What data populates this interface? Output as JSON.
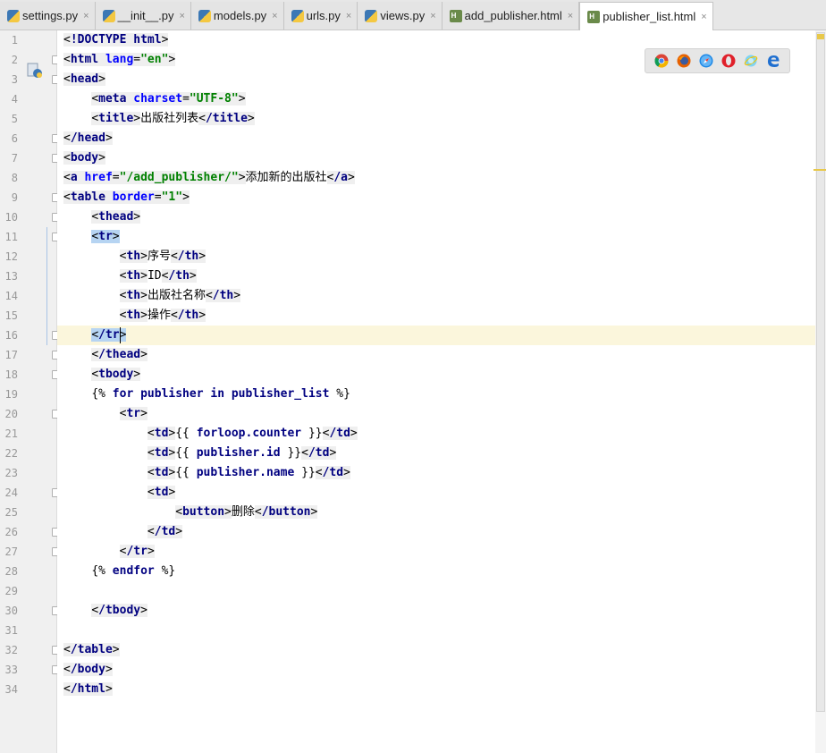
{
  "tabs": [
    {
      "label": "settings.py",
      "icon": "python-file-icon"
    },
    {
      "label": "__init__.py",
      "icon": "python-file-icon"
    },
    {
      "label": "models.py",
      "icon": "python-file-icon"
    },
    {
      "label": "urls.py",
      "icon": "python-file-icon"
    },
    {
      "label": "views.py",
      "icon": "python-file-icon"
    },
    {
      "label": "add_publisher.html",
      "icon": "html-file-icon"
    },
    {
      "label": "publisher_list.html",
      "icon": "html-file-icon",
      "active": true
    }
  ],
  "close_glyph": "×",
  "browsers": [
    "chrome",
    "firefox",
    "safari",
    "opera",
    "ie",
    "edge"
  ],
  "colors": {
    "tag": "#000080",
    "attr": "#0000ff",
    "string": "#008000",
    "caret_line": "#fbf6dc",
    "selection": "#b6d4f2"
  },
  "code": {
    "line_numbers": [
      "1",
      "2",
      "3",
      "4",
      "5",
      "6",
      "7",
      "8",
      "9",
      "10",
      "11",
      "12",
      "13",
      "14",
      "15",
      "16",
      "17",
      "18",
      "19",
      "20",
      "21",
      "22",
      "23",
      "24",
      "25",
      "26",
      "27",
      "28",
      "29",
      "30",
      "31",
      "32",
      "33",
      "34"
    ],
    "lines": [
      "<!DOCTYPE html>",
      "<html lang=\"en\">",
      "<head>",
      "    <meta charset=\"UTF-8\">",
      "    <title>出版社列表</title>",
      "</head>",
      "<body>",
      "<a href=\"/add_publisher/\">添加新的出版社</a>",
      "<table border=\"1\">",
      "    <thead>",
      "    <tr>",
      "        <th>序号</th>",
      "        <th>ID</th>",
      "        <th>出版社名称</th>",
      "        <th>操作</th>",
      "    </tr>",
      "    </thead>",
      "    <tbody>",
      "    {% for publisher in publisher_list %}",
      "        <tr>",
      "            <td>{{ forloop.counter }}</td>",
      "            <td>{{ publisher.id }}</td>",
      "            <td>{{ publisher.name }}</td>",
      "            <td>",
      "                <button>删除</button>",
      "            </td>",
      "        </tr>",
      "    {% endfor %}",
      "",
      "    </tbody>",
      "",
      "</table>",
      "</body>",
      "</html>"
    ]
  }
}
